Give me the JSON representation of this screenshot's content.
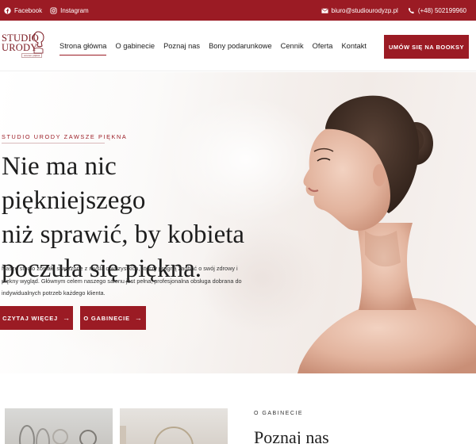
{
  "topbar": {
    "facebook": "Facebook",
    "instagram": "Instagram",
    "email": "biuro@studiourodyzp.pl",
    "phone": "(+48) 502199960"
  },
  "logo": {
    "line1": "STUDIO",
    "line2": "URODY",
    "tag": "zawsze piękna"
  },
  "nav": {
    "items": [
      {
        "label": "Strona główna",
        "active": true
      },
      {
        "label": "O gabinecie"
      },
      {
        "label": "Poznaj nas"
      },
      {
        "label": "Bony podarunkowe"
      },
      {
        "label": "Cennik"
      },
      {
        "label": "Oferta"
      },
      {
        "label": "Kontakt"
      }
    ],
    "cta": "UMÓW SIĘ NA BOOKSY"
  },
  "hero": {
    "eyebrow": "STUDIO URODY ZAWSZE PIĘKNA",
    "headline_1": "Nie ma nic piękniejszego",
    "headline_2": "niż sprawić, by kobieta",
    "headline_3": "poczuła się piękna.",
    "lead": "Nasze studio zostało stworzone z myślą o wszystkich, którzy pragną zadbać o swój zdrowy i piękny wygląd. Głównym celem naszego salonu jest pełna, profesjonalna obsługa dobrana do indywidualnych potrzeb każdego klienta.",
    "btn_more": "CZYTAJ WIĘCEJ",
    "btn_gab": "O GABINECIE",
    "arrow": "→"
  },
  "about": {
    "eyebrow": "O GABINECIE",
    "title": "Poznaj nas"
  },
  "colors": {
    "brand": "#9b1b24",
    "text": "#1e1e1e"
  },
  "icons": [
    "facebook-icon",
    "instagram-icon",
    "mail-icon",
    "phone-icon",
    "arrow-right-icon"
  ]
}
